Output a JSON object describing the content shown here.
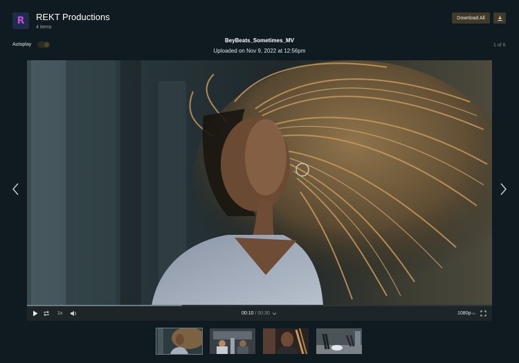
{
  "header": {
    "logo_letter": "R",
    "title": "REKT Productions",
    "item_count": "4 items",
    "download_all_label": "Download All"
  },
  "toolbar": {
    "autoplay_label": "Autoplay",
    "autoplay_on": true
  },
  "media": {
    "file_name": "BeyBeats_Sometimes_MV",
    "uploaded": "Uploaded on Nov 9, 2022 at 12:56pm",
    "position": "1 of 6"
  },
  "player": {
    "current_time": "00:10",
    "separator": " / ",
    "duration": "00:30",
    "speed": "1x",
    "quality": "1080p",
    "quality_badge": "HD",
    "progress_fraction": 0.333
  },
  "thumbnails": [
    {
      "name": "thumb-braids",
      "active": true
    },
    {
      "name": "thumb-stage",
      "active": false
    },
    {
      "name": "thumb-closeup",
      "active": false
    },
    {
      "name": "thumb-dancers",
      "active": false
    }
  ],
  "colors": {
    "background": "#0f1b21",
    "button": "#3f3a29",
    "logo_bg": "#1e2c4a",
    "logo_accent": "#c24ddc"
  },
  "icons": [
    "logo-icon",
    "download-icon",
    "chevron-left-icon",
    "chevron-right-icon",
    "play-icon",
    "loop-icon",
    "volume-icon",
    "chevron-down-icon",
    "fullscreen-icon"
  ]
}
